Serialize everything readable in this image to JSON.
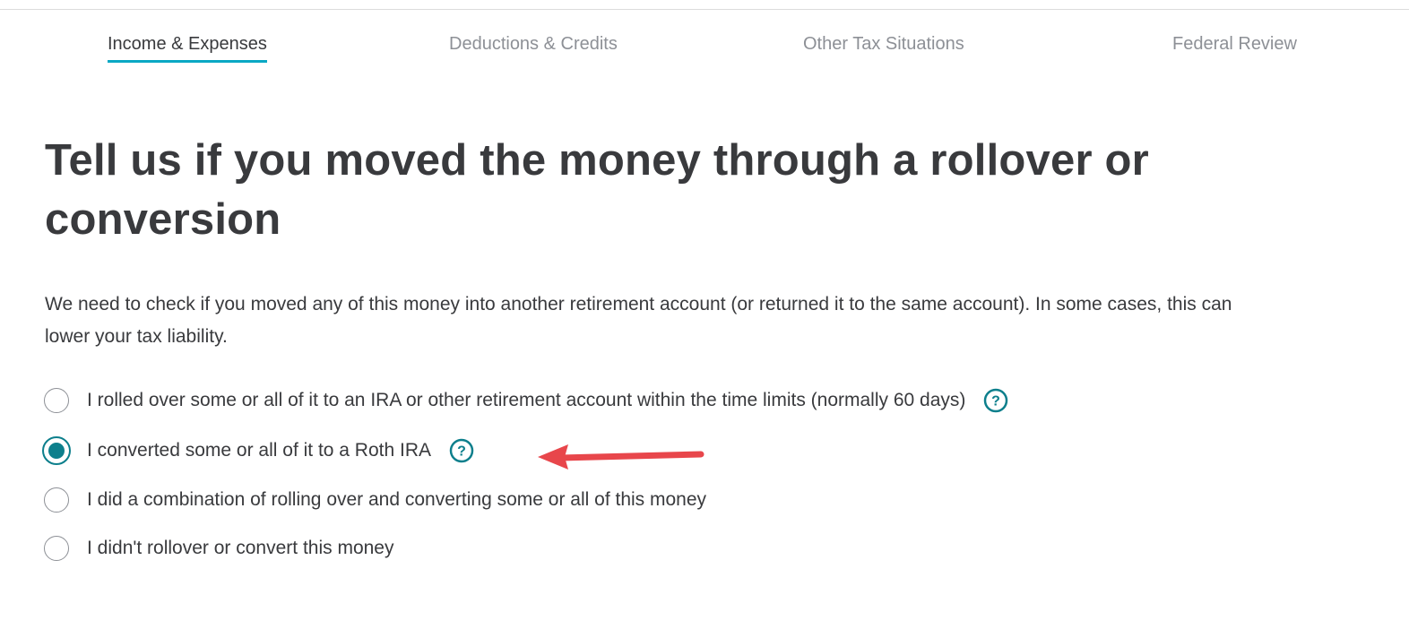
{
  "tabs": [
    {
      "label": "Income & Expenses",
      "active": true
    },
    {
      "label": "Deductions & Credits",
      "active": false
    },
    {
      "label": "Other Tax Situations",
      "active": false
    },
    {
      "label": "Federal Review",
      "active": false
    }
  ],
  "page": {
    "title": "Tell us if you moved the money through a rollover or conversion",
    "description": "We need to check if you moved any of this money into another retirement account (or returned it to the same account). In some cases, this can lower your tax liability."
  },
  "options": [
    {
      "label": "I rolled over some or all of it to an IRA or other retirement account within the time limits (normally 60 days)",
      "selected": false,
      "has_help": true
    },
    {
      "label": "I converted some or all of it to a Roth IRA",
      "selected": true,
      "has_help": true
    },
    {
      "label": "I did a combination of rolling over and converting some or all of this money",
      "selected": false,
      "has_help": false
    },
    {
      "label": "I didn't rollover or convert this money",
      "selected": false,
      "has_help": false
    }
  ],
  "icons": {
    "help": "question-circle-icon",
    "annotation": "red-arrow-icon"
  },
  "colors": {
    "accent_underline": "#0aa8c4",
    "radio_selected": "#0d7f8c",
    "help_icon": "#0d7f8c",
    "annotation_arrow": "#e8464b",
    "text_primary": "#393a3d",
    "text_muted": "#8d9096"
  }
}
